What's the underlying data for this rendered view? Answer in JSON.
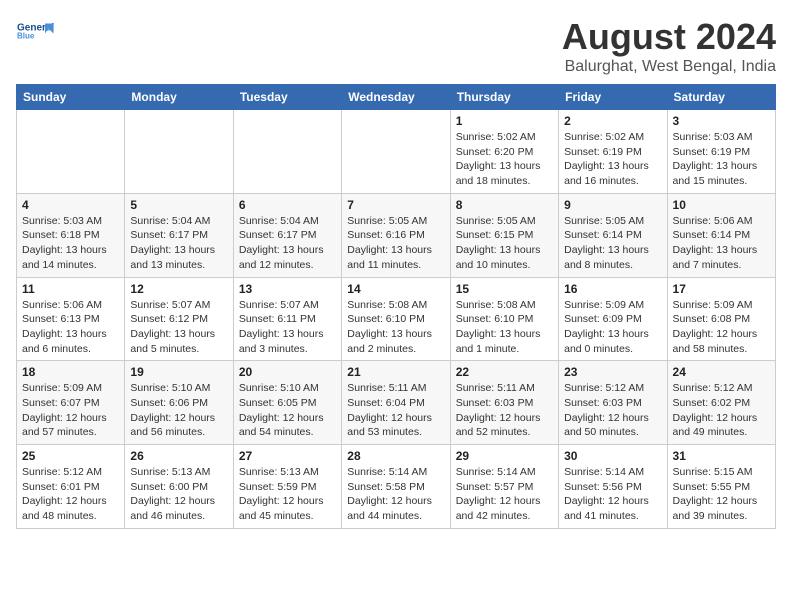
{
  "logo": {
    "line1": "General",
    "line2": "Blue"
  },
  "title": "August 2024",
  "location": "Balurghat, West Bengal, India",
  "weekdays": [
    "Sunday",
    "Monday",
    "Tuesday",
    "Wednesday",
    "Thursday",
    "Friday",
    "Saturday"
  ],
  "weeks": [
    [
      {
        "day": "",
        "info": ""
      },
      {
        "day": "",
        "info": ""
      },
      {
        "day": "",
        "info": ""
      },
      {
        "day": "",
        "info": ""
      },
      {
        "day": "1",
        "info": "Sunrise: 5:02 AM\nSunset: 6:20 PM\nDaylight: 13 hours\nand 18 minutes."
      },
      {
        "day": "2",
        "info": "Sunrise: 5:02 AM\nSunset: 6:19 PM\nDaylight: 13 hours\nand 16 minutes."
      },
      {
        "day": "3",
        "info": "Sunrise: 5:03 AM\nSunset: 6:19 PM\nDaylight: 13 hours\nand 15 minutes."
      }
    ],
    [
      {
        "day": "4",
        "info": "Sunrise: 5:03 AM\nSunset: 6:18 PM\nDaylight: 13 hours\nand 14 minutes."
      },
      {
        "day": "5",
        "info": "Sunrise: 5:04 AM\nSunset: 6:17 PM\nDaylight: 13 hours\nand 13 minutes."
      },
      {
        "day": "6",
        "info": "Sunrise: 5:04 AM\nSunset: 6:17 PM\nDaylight: 13 hours\nand 12 minutes."
      },
      {
        "day": "7",
        "info": "Sunrise: 5:05 AM\nSunset: 6:16 PM\nDaylight: 13 hours\nand 11 minutes."
      },
      {
        "day": "8",
        "info": "Sunrise: 5:05 AM\nSunset: 6:15 PM\nDaylight: 13 hours\nand 10 minutes."
      },
      {
        "day": "9",
        "info": "Sunrise: 5:05 AM\nSunset: 6:14 PM\nDaylight: 13 hours\nand 8 minutes."
      },
      {
        "day": "10",
        "info": "Sunrise: 5:06 AM\nSunset: 6:14 PM\nDaylight: 13 hours\nand 7 minutes."
      }
    ],
    [
      {
        "day": "11",
        "info": "Sunrise: 5:06 AM\nSunset: 6:13 PM\nDaylight: 13 hours\nand 6 minutes."
      },
      {
        "day": "12",
        "info": "Sunrise: 5:07 AM\nSunset: 6:12 PM\nDaylight: 13 hours\nand 5 minutes."
      },
      {
        "day": "13",
        "info": "Sunrise: 5:07 AM\nSunset: 6:11 PM\nDaylight: 13 hours\nand 3 minutes."
      },
      {
        "day": "14",
        "info": "Sunrise: 5:08 AM\nSunset: 6:10 PM\nDaylight: 13 hours\nand 2 minutes."
      },
      {
        "day": "15",
        "info": "Sunrise: 5:08 AM\nSunset: 6:10 PM\nDaylight: 13 hours\nand 1 minute."
      },
      {
        "day": "16",
        "info": "Sunrise: 5:09 AM\nSunset: 6:09 PM\nDaylight: 13 hours\nand 0 minutes."
      },
      {
        "day": "17",
        "info": "Sunrise: 5:09 AM\nSunset: 6:08 PM\nDaylight: 12 hours\nand 58 minutes."
      }
    ],
    [
      {
        "day": "18",
        "info": "Sunrise: 5:09 AM\nSunset: 6:07 PM\nDaylight: 12 hours\nand 57 minutes."
      },
      {
        "day": "19",
        "info": "Sunrise: 5:10 AM\nSunset: 6:06 PM\nDaylight: 12 hours\nand 56 minutes."
      },
      {
        "day": "20",
        "info": "Sunrise: 5:10 AM\nSunset: 6:05 PM\nDaylight: 12 hours\nand 54 minutes."
      },
      {
        "day": "21",
        "info": "Sunrise: 5:11 AM\nSunset: 6:04 PM\nDaylight: 12 hours\nand 53 minutes."
      },
      {
        "day": "22",
        "info": "Sunrise: 5:11 AM\nSunset: 6:03 PM\nDaylight: 12 hours\nand 52 minutes."
      },
      {
        "day": "23",
        "info": "Sunrise: 5:12 AM\nSunset: 6:03 PM\nDaylight: 12 hours\nand 50 minutes."
      },
      {
        "day": "24",
        "info": "Sunrise: 5:12 AM\nSunset: 6:02 PM\nDaylight: 12 hours\nand 49 minutes."
      }
    ],
    [
      {
        "day": "25",
        "info": "Sunrise: 5:12 AM\nSunset: 6:01 PM\nDaylight: 12 hours\nand 48 minutes."
      },
      {
        "day": "26",
        "info": "Sunrise: 5:13 AM\nSunset: 6:00 PM\nDaylight: 12 hours\nand 46 minutes."
      },
      {
        "day": "27",
        "info": "Sunrise: 5:13 AM\nSunset: 5:59 PM\nDaylight: 12 hours\nand 45 minutes."
      },
      {
        "day": "28",
        "info": "Sunrise: 5:14 AM\nSunset: 5:58 PM\nDaylight: 12 hours\nand 44 minutes."
      },
      {
        "day": "29",
        "info": "Sunrise: 5:14 AM\nSunset: 5:57 PM\nDaylight: 12 hours\nand 42 minutes."
      },
      {
        "day": "30",
        "info": "Sunrise: 5:14 AM\nSunset: 5:56 PM\nDaylight: 12 hours\nand 41 minutes."
      },
      {
        "day": "31",
        "info": "Sunrise: 5:15 AM\nSunset: 5:55 PM\nDaylight: 12 hours\nand 39 minutes."
      }
    ]
  ]
}
